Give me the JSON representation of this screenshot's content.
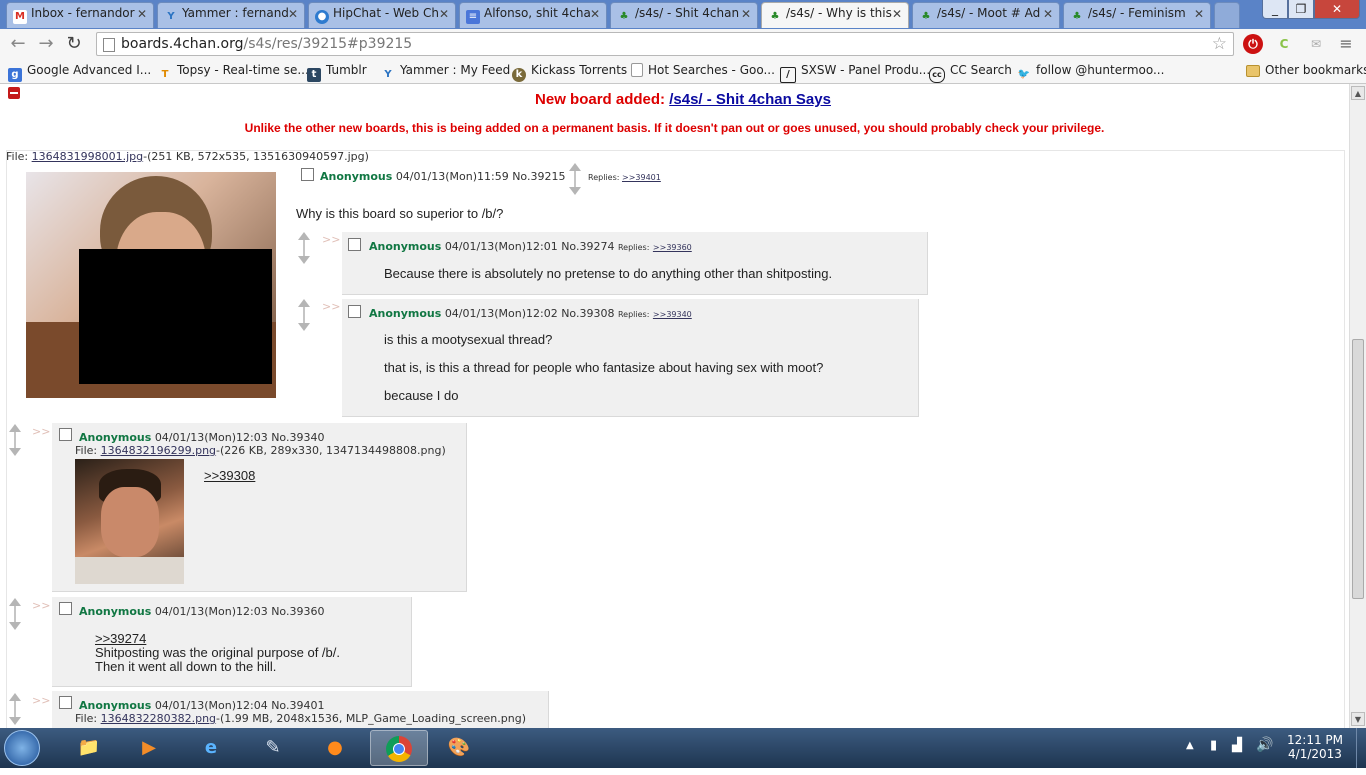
{
  "browser": {
    "tabs": [
      {
        "label": "Inbox - fernandor",
        "icon": "gmail-icon",
        "active": false
      },
      {
        "label": "Yammer : fernand",
        "icon": "yammer-icon",
        "active": false
      },
      {
        "label": "HipChat - Web Ch",
        "icon": "hipchat-icon",
        "active": false
      },
      {
        "label": "Alfonso, shit 4cha",
        "icon": "docs-icon",
        "active": false
      },
      {
        "label": "/s4s/ - Shit 4chan",
        "icon": "4chan-clover-icon",
        "active": false
      },
      {
        "label": "/s4s/ - Why is this",
        "icon": "4chan-clover-icon",
        "active": true
      },
      {
        "label": "/s4s/ - Moot # Ad",
        "icon": "4chan-clover-icon",
        "active": false
      },
      {
        "label": "/s4s/ - Feminism",
        "icon": "4chan-clover-icon",
        "active": false
      }
    ],
    "url_host": "boards.4chan.org",
    "url_path": "/s4s/res/39215#p39215",
    "bookmarks": [
      {
        "label": "Google Advanced I...",
        "icon": "google-icon"
      },
      {
        "label": "Topsy - Real-time se...",
        "icon": "topsy-icon"
      },
      {
        "label": "Tumblr",
        "icon": "tumblr-icon"
      },
      {
        "label": "Yammer : My Feed",
        "icon": "yammer-icon"
      },
      {
        "label": "Kickass Torrents",
        "icon": "kickass-icon"
      },
      {
        "label": "Hot Searches - Goo...",
        "icon": "page-icon"
      },
      {
        "label": "SXSW - Panel Produ...",
        "icon": "sxsw-icon"
      },
      {
        "label": "CC Search",
        "icon": "cc-icon"
      },
      {
        "label": "follow @huntermoo...",
        "icon": "twitter-icon"
      }
    ],
    "other_bookmarks": "Other bookmarks"
  },
  "page": {
    "announcement_prefix": "New board added:",
    "announcement_link": "/s4s/ - Shit 4chan Says",
    "announcement_note": "Unlike the other new boards, this is being added on a permanent basis. If it doesn't pan out or goes unused, you should probably check your privilege.",
    "op": {
      "file_label": "File:",
      "file_link": "1364831998001.jpg",
      "file_meta": "-(251 KB, 572x535, 1351630940597.jpg)",
      "name": "Anonymous",
      "datetime": "04/01/13(Mon)11:59",
      "number": "No.39215",
      "replies_label": "Replies:",
      "replies": ">>39401",
      "message": "Why is this board so superior to /b/?"
    },
    "replies": [
      {
        "name": "Anonymous",
        "datetime": "04/01/13(Mon)12:01",
        "number": "No.39274",
        "replies_label": "Replies:",
        "replies": ">>39360",
        "lines": [
          "Because there is absolutely no pretense to do anything other than shitposting."
        ]
      },
      {
        "name": "Anonymous",
        "datetime": "04/01/13(Mon)12:02",
        "number": "No.39308",
        "replies_label": "Replies:",
        "replies": ">>39340",
        "lines": [
          "is this a mootysexual thread?",
          "that is, is this a thread for people who fantasize about having sex with moot?",
          "because I do"
        ]
      },
      {
        "name": "Anonymous",
        "datetime": "04/01/13(Mon)12:03",
        "number": "No.39340",
        "file_label": "File:",
        "file_link": "1364832196299.png",
        "file_meta": "-(226 KB, 289x330, 1347134498808.png)",
        "quote": ">>39308"
      },
      {
        "name": "Anonymous",
        "datetime": "04/01/13(Mon)12:03",
        "number": "No.39360",
        "quote": ">>39274",
        "lines": [
          "Shitposting was the original purpose of /b/.",
          "Then it went all down to the hill."
        ]
      },
      {
        "name": "Anonymous",
        "datetime": "04/01/13(Mon)12:04",
        "number": "No.39401",
        "file_label": "File:",
        "file_link": "1364832280382.png",
        "file_meta": "-(1.99 MB, 2048x1536, MLP_Game_Loading_screen.png)"
      }
    ],
    "reply_marker": ">>"
  },
  "taskbar": {
    "time": "12:11 PM",
    "date": "4/1/2013"
  }
}
